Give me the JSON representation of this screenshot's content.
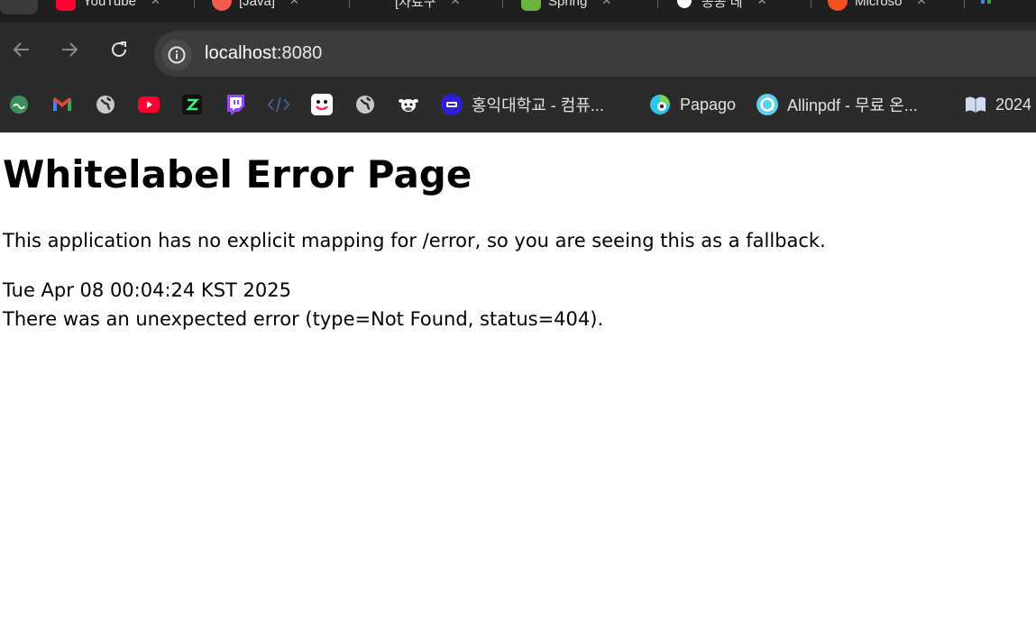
{
  "browser": {
    "tabs": [
      {
        "title": "YouTube",
        "color": "#ff0033"
      },
      {
        "title": "[Java]",
        "color": "#f55a4e"
      },
      {
        "title": "[자료구",
        "color": "#888888"
      },
      {
        "title": "Spring",
        "color": "#6db33f"
      },
      {
        "title": "공공 데",
        "color": "#ffffff"
      },
      {
        "title": "Microso",
        "color": "#f25022"
      }
    ],
    "address": {
      "host": "localhost",
      "port": ":8080"
    },
    "bookmarks": [
      {
        "label": "",
        "icon": "tree-icon"
      },
      {
        "label": "",
        "icon": "gmail-icon"
      },
      {
        "label": "",
        "icon": "globe-icon"
      },
      {
        "label": "",
        "icon": "youtube-icon"
      },
      {
        "label": "",
        "icon": "z-icon"
      },
      {
        "label": "",
        "icon": "twitch-icon"
      },
      {
        "label": "",
        "icon": "code-icon"
      },
      {
        "label": "",
        "icon": "smile-icon"
      },
      {
        "label": "",
        "icon": "globe-icon"
      },
      {
        "label": "",
        "icon": "cow-icon"
      },
      {
        "label": "홍익대학교 - 컴퓨...",
        "icon": "hongik-icon"
      },
      {
        "label": "Papago",
        "icon": "papago-icon"
      },
      {
        "label": "Allinpdf - 무료 온...",
        "icon": "allinpdf-icon"
      },
      {
        "label": "2024",
        "icon": "book-icon"
      }
    ]
  },
  "page": {
    "heading": "Whitelabel Error Page",
    "description": "This application has no explicit mapping for /error, so you are seeing this as a fallback.",
    "timestamp": "Tue Apr 08 00:04:24 KST 2025",
    "error": "There was an unexpected error (type=Not Found, status=404)."
  }
}
